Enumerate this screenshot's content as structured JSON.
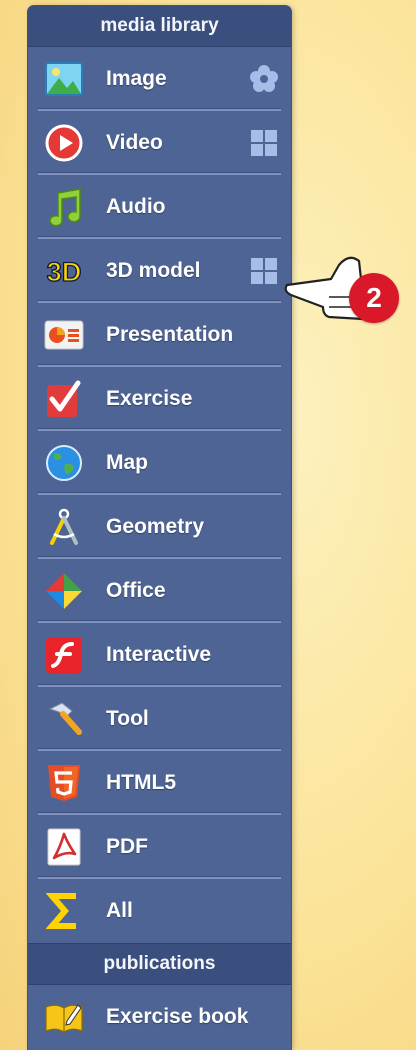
{
  "library": {
    "header": "media library",
    "items": [
      {
        "label": "Image",
        "icon": "image-icon",
        "right_icon": "flower-icon"
      },
      {
        "label": "Video",
        "icon": "play-icon",
        "right_icon": "grid-icon"
      },
      {
        "label": "Audio",
        "icon": "music-note-icon"
      },
      {
        "label": "3D model",
        "icon": "3d-icon",
        "right_icon": "grid-icon"
      },
      {
        "label": "Presentation",
        "icon": "presentation-icon"
      },
      {
        "label": "Exercise",
        "icon": "checkmark-icon"
      },
      {
        "label": "Map",
        "icon": "globe-icon"
      },
      {
        "label": "Geometry",
        "icon": "compass-icon"
      },
      {
        "label": "Office",
        "icon": "office-diamond-icon"
      },
      {
        "label": "Interactive",
        "icon": "flash-icon"
      },
      {
        "label": "Tool",
        "icon": "hammer-icon"
      },
      {
        "label": "HTML5",
        "icon": "html5-icon"
      },
      {
        "label": "PDF",
        "icon": "pdf-icon"
      },
      {
        "label": "All",
        "icon": "sigma-icon"
      }
    ]
  },
  "publications": {
    "header": "publications",
    "items": [
      {
        "label": "Exercise book",
        "icon": "exercise-book-icon"
      }
    ]
  },
  "callout": {
    "number": "2",
    "icon": "pointing-hand-icon"
  },
  "colors": {
    "panel": "#4e6494",
    "header": "#3a4f7d",
    "badge": "#d9192a",
    "background": "#fbe49a"
  }
}
